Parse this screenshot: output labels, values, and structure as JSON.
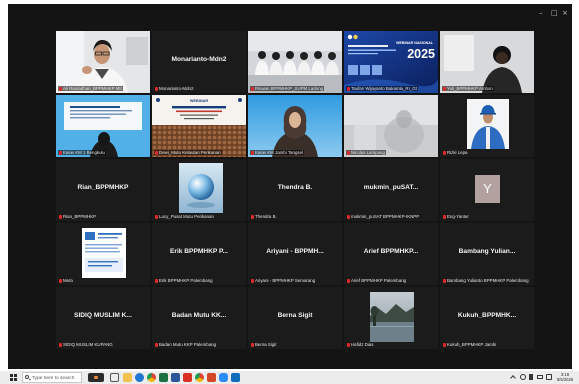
{
  "window": {
    "minimize": "–",
    "maximize": "□",
    "close": "×"
  },
  "tiles": [
    {
      "label": "Ali Ramadhan_BPPMHKP Mtr"
    },
    {
      "label": "Monarianto-Mdn2",
      "display_name": "Monarianto-Mdn2"
    },
    {
      "label": "Riswan BPPMHKP_SUPM Ladong"
    },
    {
      "label": "Taufan Wijayanto Bakamla_RI_Gt",
      "slide_title": "WEBINAR NASIONAL",
      "slide_year": "2025"
    },
    {
      "label": "Yuli_BPPMHKP Ambon"
    },
    {
      "label": "Kasie KM 1 Bengkulu"
    },
    {
      "label": "Dewi_Mutu Kelautan Perikanan",
      "slide_title": "WEBINAR"
    },
    {
      "label": "Kasie KM Jambi Tangsel"
    },
    {
      "label": "Nicolas Lampung"
    },
    {
      "label": "Rizki Lepa"
    },
    {
      "label": "Rian_BPPMHKP",
      "display_name": "Rian_BPPMHKP"
    },
    {
      "label": "Lucy_Pusat Mutu Perikanan"
    },
    {
      "label": "Thendra B.",
      "display_name": "Thendra B."
    },
    {
      "label": "mukmin_puSAT BPPMHKP-IKNPP",
      "display_name": "mukmin_puSAT..."
    },
    {
      "label": "Eng-Yanter",
      "initial": "Y"
    },
    {
      "label": "Meta"
    },
    {
      "label": "Erik BPPMHKP Palembang",
      "display_name": "Erik BPPMHKP P..."
    },
    {
      "label": "Ariyani - BPPMHKP Semarang",
      "display_name": "Ariyani - BPPMH..."
    },
    {
      "label": "Arief BPPMHKP Palembang",
      "display_name": "Arief BPPMHKP..."
    },
    {
      "label": "Bambang Yulianto BPPMHKP Palembang",
      "display_name": "Bambang Yulian..."
    },
    {
      "label": "SIDIQ MUSLIM KUPANG",
      "display_name": "SIDIQ MUSLIM K..."
    },
    {
      "label": "Badan Mutu KKP Palembang",
      "display_name": "Badan Mutu KK..."
    },
    {
      "label": "Berna Sigit",
      "display_name": "Berna Sigit"
    },
    {
      "label": "Hafidz Dias"
    },
    {
      "label": "Kukuh_BPPMHKP Jambi",
      "display_name": "Kukuh_BPPMHK..."
    }
  ],
  "taskbar": {
    "search_placeholder": "Type here to search",
    "time": "3:19",
    "date": "5/5/2025"
  },
  "colors": {
    "background": "#141414",
    "tile": "#1b1b1b",
    "active_speaker": "#3fbf5f",
    "muted": "#e02828"
  },
  "icons": [
    "windows-start-icon",
    "search-icon",
    "app-icon",
    "task-view-icon",
    "file-explorer-icon",
    "edge-icon",
    "chrome-icon",
    "excel-icon",
    "word-icon",
    "pdf-icon",
    "powerpoint-icon",
    "zoom-icon",
    "outlook-icon",
    "chevron-up-icon",
    "network-icon",
    "volume-icon",
    "battery-icon",
    "notification-icon",
    "muted-microphone-icon"
  ]
}
